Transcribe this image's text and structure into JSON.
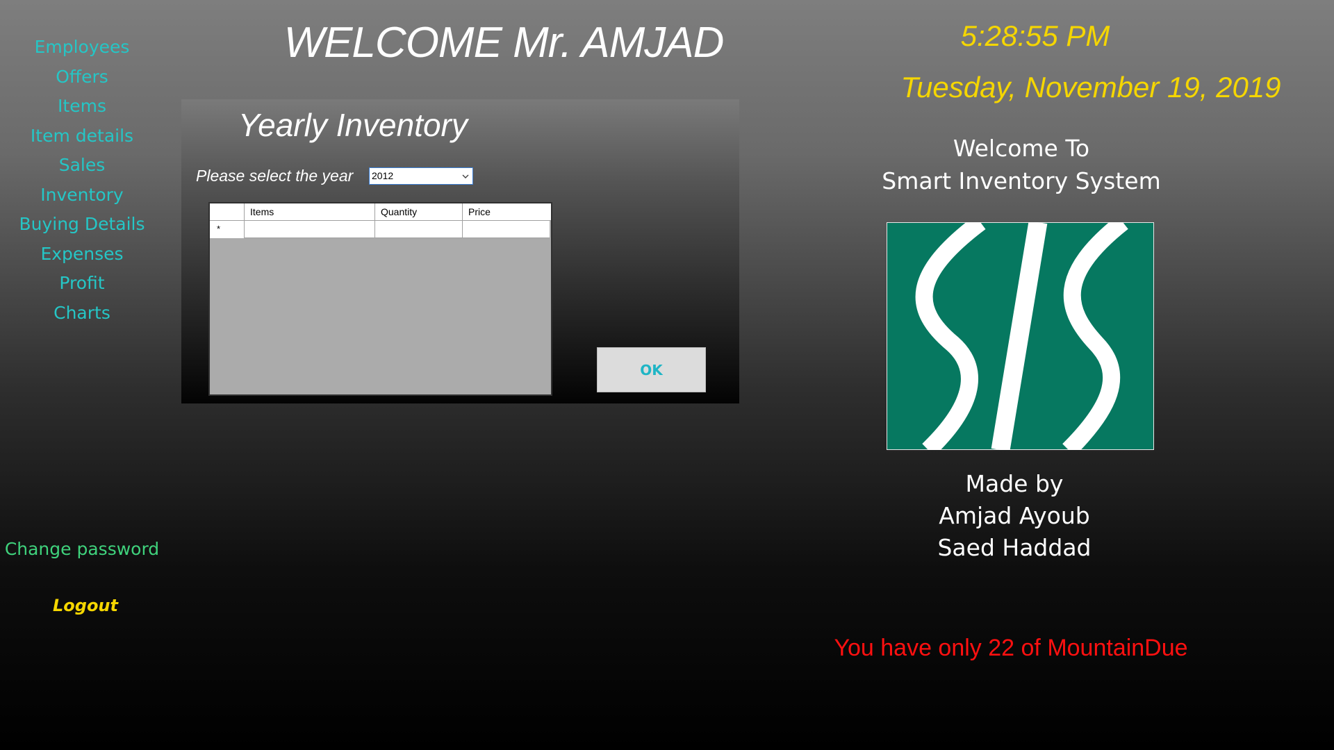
{
  "sidebar": {
    "items": [
      {
        "label": "Employees"
      },
      {
        "label": "Offers"
      },
      {
        "label": "Items"
      },
      {
        "label": "Item details"
      },
      {
        "label": "Sales"
      },
      {
        "label": "Inventory"
      },
      {
        "label": "Buying Details"
      },
      {
        "label": "Expenses"
      },
      {
        "label": "Profit"
      },
      {
        "label": "Charts"
      }
    ],
    "change_password": "Change password",
    "logout": "Logout"
  },
  "header": {
    "welcome": "WELCOME Mr. AMJAD",
    "time": "5:28:55 PM",
    "date": "Tuesday, November 19, 2019"
  },
  "inventory_panel": {
    "title": "Yearly Inventory",
    "year_label": "Please select the year",
    "year_value": "2012",
    "grid": {
      "columns": [
        "Items",
        "Quantity",
        "Price"
      ],
      "new_row_marker": "*"
    },
    "ok_label": "OK"
  },
  "info": {
    "welcome_line1": "Welcome To",
    "welcome_line2": "Smart Inventory System",
    "logo_icon": "sis-logo-icon",
    "made_by": "Made by",
    "author1": "Amjad Ayoub",
    "author2": "Saed Haddad",
    "stock_warning": "You have only 22 of MountainDue"
  },
  "colors": {
    "nav_text": "#25c6c6",
    "change_password": "#3fd27c",
    "logout": "#f5d600",
    "clock": "#f5d600",
    "warning": "#ff1010",
    "logo_green": "#067860"
  }
}
